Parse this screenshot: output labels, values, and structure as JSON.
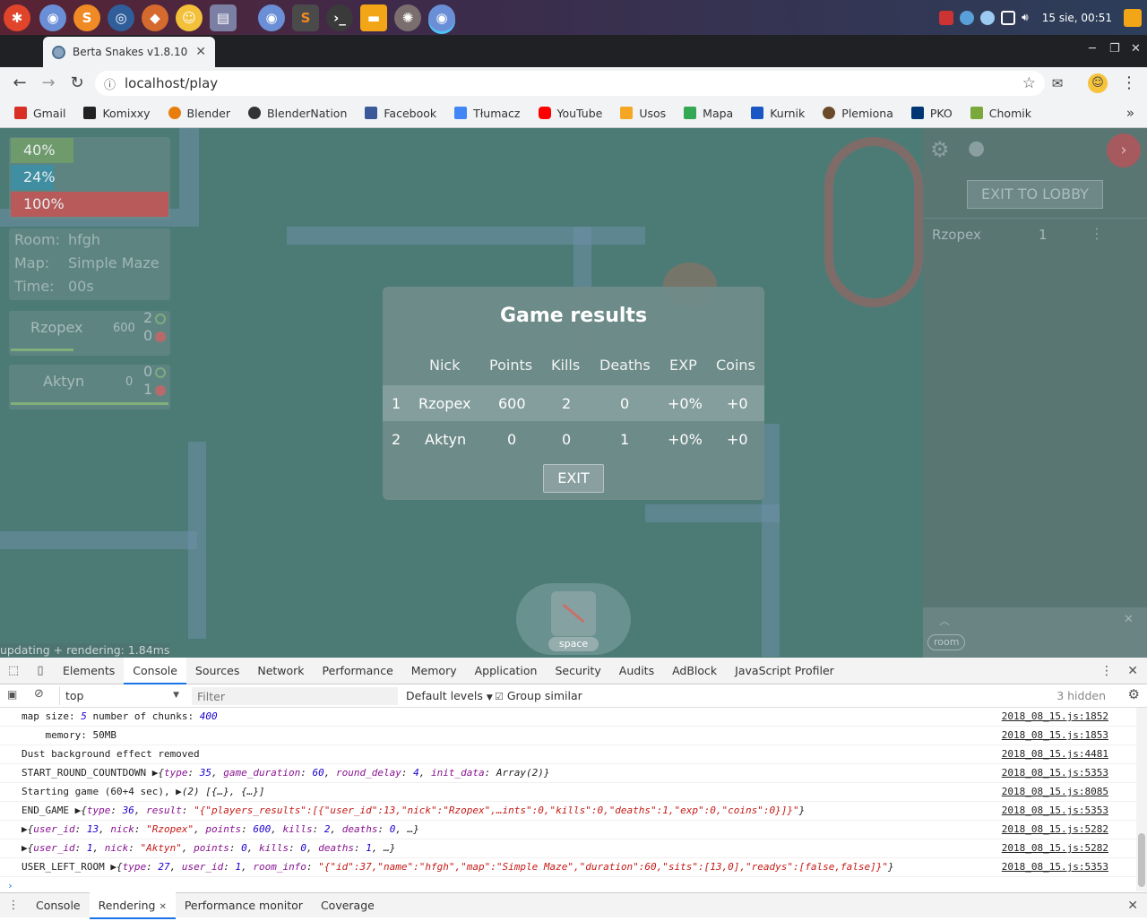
{
  "taskbar": {
    "clock": "15 sie, 00:51"
  },
  "browser": {
    "tab_title": "Berta Snakes v1.8.10",
    "url": "localhost/play",
    "bookmarks": [
      {
        "label": "Gmail",
        "color": "#d93025"
      },
      {
        "label": "Komixxy",
        "color": "#222222"
      },
      {
        "label": "Blender",
        "color": "#e87d0d"
      },
      {
        "label": "BlenderNation",
        "color": "#333333"
      },
      {
        "label": "Facebook",
        "color": "#3b5998"
      },
      {
        "label": "Tłumacz",
        "color": "#4285f4"
      },
      {
        "label": "YouTube",
        "color": "#ff0000"
      },
      {
        "label": "Usos",
        "color": "#f5a623"
      },
      {
        "label": "Mapa",
        "color": "#34a853"
      },
      {
        "label": "Kurnik",
        "color": "#1a56c4"
      },
      {
        "label": "Plemiona",
        "color": "#6b4a2a"
      },
      {
        "label": "PKO",
        "color": "#003574"
      },
      {
        "label": "Chomik",
        "color": "#7aa83a"
      }
    ]
  },
  "game": {
    "bars": [
      "40%",
      "24%",
      "100%"
    ],
    "room_info": {
      "room_label": "Room:",
      "room_value": "hfgh",
      "map_label": "Map:",
      "map_value": "Simple Maze",
      "time_label": "Time:",
      "time_value": "00s"
    },
    "players": [
      {
        "nick": "Rzopex",
        "points": "600",
        "kills": "2",
        "deaths": "0"
      },
      {
        "nick": "Aktyn",
        "points": "0",
        "kills": "0",
        "deaths": "1"
      }
    ],
    "right_panel": {
      "exit_lobby": "EXIT TO LOBBY",
      "player_nick": "Rzopex",
      "player_value": "1",
      "room_tag": "room"
    },
    "results": {
      "title": "Game results",
      "headers": [
        "Nick",
        "Points",
        "Kills",
        "Deaths",
        "EXP",
        "Coins"
      ],
      "rows": [
        {
          "rank": "1",
          "nick": "Rzopex",
          "points": "600",
          "kills": "2",
          "deaths": "0",
          "exp": "+0%",
          "coins": "+0"
        },
        {
          "rank": "2",
          "nick": "Aktyn",
          "points": "0",
          "kills": "0",
          "deaths": "1",
          "exp": "+0%",
          "coins": "+0"
        }
      ],
      "exit_label": "EXIT"
    },
    "space_label": "space",
    "fps_text": "updating + rendering: 1.84ms"
  },
  "devtools": {
    "tabs": [
      "Elements",
      "Console",
      "Sources",
      "Network",
      "Performance",
      "Memory",
      "Application",
      "Security",
      "Audits",
      "AdBlock",
      "JavaScript Profiler"
    ],
    "context": "top",
    "filter_placeholder": "Filter",
    "levels": "Default levels",
    "group_similar": "Group similar",
    "hidden": "3 hidden",
    "drawer_tabs": [
      "Console",
      "Rendering",
      "Performance monitor",
      "Coverage"
    ],
    "sources": [
      "2018_08_15.js:1852",
      "2018_08_15.js:1853",
      "2018_08_15.js:4481",
      "2018_08_15.js:5353",
      "2018_08_15.js:8085",
      "2018_08_15.js:5353",
      "2018_08_15.js:5282",
      "2018_08_15.js:5282",
      "2018_08_15.js:5353"
    ]
  }
}
